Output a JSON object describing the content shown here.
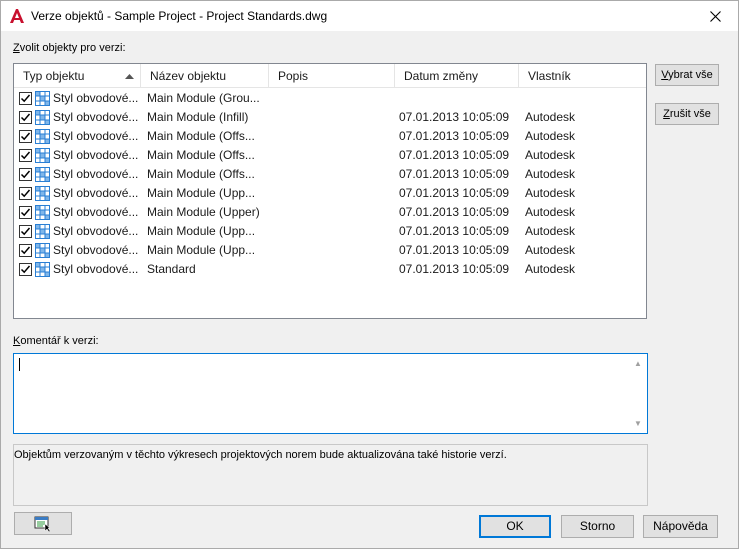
{
  "window": {
    "title": "Verze objektů - Sample Project - Project Standards.dwg"
  },
  "select_label": "Zvolit objekty pro verzi:",
  "select_label_accel": "Z",
  "select_label_rest": "volit objekty pro verzi:",
  "columns": [
    "Typ objektu",
    "Název objektu",
    "Popis",
    "Datum změny",
    "Vlastník"
  ],
  "rows": [
    {
      "checked": true,
      "type": "Styl obvodové...",
      "name": "Main Module (Grou...",
      "desc": "",
      "date": "",
      "owner": ""
    },
    {
      "checked": true,
      "type": "Styl obvodové...",
      "name": "Main Module (Infill)",
      "desc": "",
      "date": "07.01.2013 10:05:09",
      "owner": "Autodesk"
    },
    {
      "checked": true,
      "type": "Styl obvodové...",
      "name": "Main Module (Offs...",
      "desc": "",
      "date": "07.01.2013 10:05:09",
      "owner": "Autodesk"
    },
    {
      "checked": true,
      "type": "Styl obvodové...",
      "name": "Main Module (Offs...",
      "desc": "",
      "date": "07.01.2013 10:05:09",
      "owner": "Autodesk"
    },
    {
      "checked": true,
      "type": "Styl obvodové...",
      "name": "Main Module (Offs...",
      "desc": "",
      "date": "07.01.2013 10:05:09",
      "owner": "Autodesk"
    },
    {
      "checked": true,
      "type": "Styl obvodové...",
      "name": "Main Module (Upp...",
      "desc": "",
      "date": "07.01.2013 10:05:09",
      "owner": "Autodesk"
    },
    {
      "checked": true,
      "type": "Styl obvodové...",
      "name": "Main Module (Upper)",
      "desc": "",
      "date": "07.01.2013 10:05:09",
      "owner": "Autodesk"
    },
    {
      "checked": true,
      "type": "Styl obvodové...",
      "name": "Main Module (Upp...",
      "desc": "",
      "date": "07.01.2013 10:05:09",
      "owner": "Autodesk"
    },
    {
      "checked": true,
      "type": "Styl obvodové...",
      "name": "Main Module (Upp...",
      "desc": "",
      "date": "07.01.2013 10:05:09",
      "owner": "Autodesk"
    },
    {
      "checked": true,
      "type": "Styl obvodové...",
      "name": "Standard",
      "desc": "",
      "date": "07.01.2013 10:05:09",
      "owner": "Autodesk"
    }
  ],
  "buttons": {
    "select_all": "Vybrat vše",
    "select_all_accel": "V",
    "select_all_rest": "ybrat vše",
    "deselect_all": "Zrušit vše",
    "deselect_all_accel": "Z",
    "deselect_all_rest": "rušit vše",
    "ok": "OK",
    "cancel": "Storno",
    "help": "Nápověda"
  },
  "comment": {
    "label": "Komentář k verzi:",
    "label_accel": "K",
    "label_rest": "omentář k verzi:",
    "value": ""
  },
  "info_text": "Objektům verzovaným v těchto výkresech projektových norem bude aktualizována také historie verzí.",
  "colors": {
    "accent": "#0078d7",
    "app_icon": "#c8102e",
    "row_icon": "#2a7fd4"
  },
  "icons": {
    "app": "autocad-logo-icon",
    "close": "close-icon",
    "sort": "sort-ascending-icon",
    "row": "curtain-wall-style-icon",
    "bottom_left": "window-cursor-icon"
  }
}
